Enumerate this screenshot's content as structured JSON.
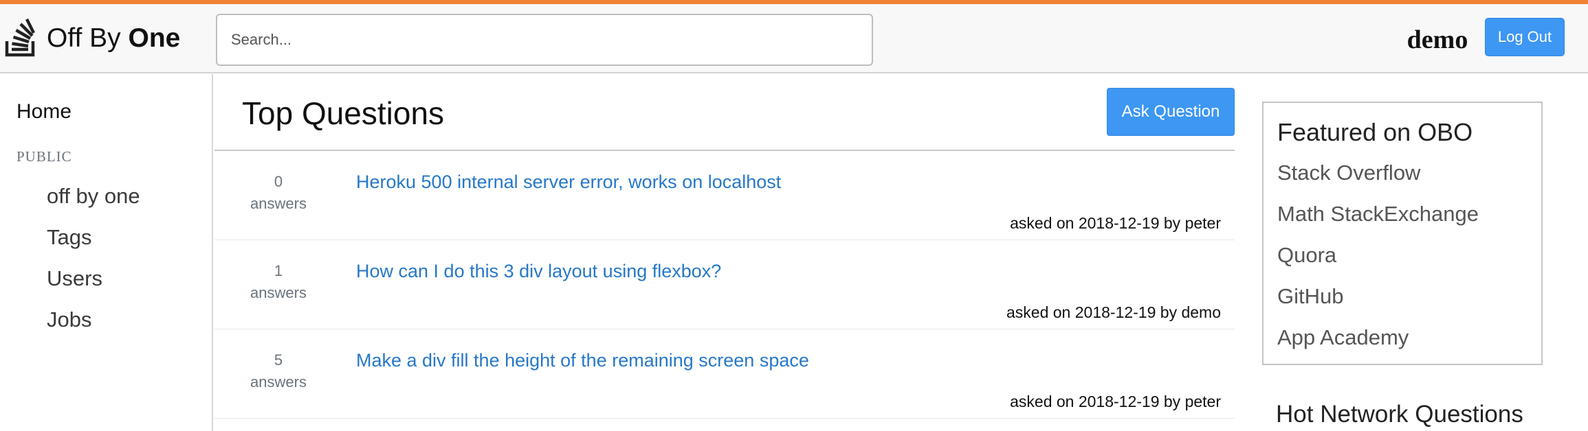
{
  "colors": {
    "accent_strip": "#ef8236",
    "primary_button": "#3d97f3",
    "link": "#2678c8"
  },
  "brand": {
    "name_regular": "Off By",
    "name_bold": "One",
    "icon": "stacked-trays-icon"
  },
  "search": {
    "placeholder": "Search..."
  },
  "user": {
    "name": "demo",
    "logout_label": "Log Out"
  },
  "sidebar": {
    "home_label": "Home",
    "section_label": "PUBLIC",
    "items": [
      {
        "label": "off by one"
      },
      {
        "label": "Tags"
      },
      {
        "label": "Users"
      },
      {
        "label": "Jobs"
      }
    ]
  },
  "main": {
    "title": "Top Questions",
    "ask_label": "Ask Question",
    "questions": [
      {
        "count": "0",
        "count_unit": "answers",
        "title": "Heroku 500 internal server error, works on localhost",
        "meta": "asked on 2018-12-19 by peter"
      },
      {
        "count": "1",
        "count_unit": "answers",
        "title": "How can I do this 3 div layout using flexbox?",
        "meta": "asked on 2018-12-19 by demo"
      },
      {
        "count": "5",
        "count_unit": "answers",
        "title": "Make a div fill the height of the remaining screen space",
        "meta": "asked on 2018-12-19 by peter"
      }
    ]
  },
  "featured": {
    "title": "Featured on OBO",
    "links": [
      {
        "label": "Stack Overflow"
      },
      {
        "label": "Math StackExchange"
      },
      {
        "label": "Quora"
      },
      {
        "label": "GitHub"
      },
      {
        "label": "App Academy"
      }
    ]
  },
  "hot": {
    "title": "Hot Network Questions"
  }
}
